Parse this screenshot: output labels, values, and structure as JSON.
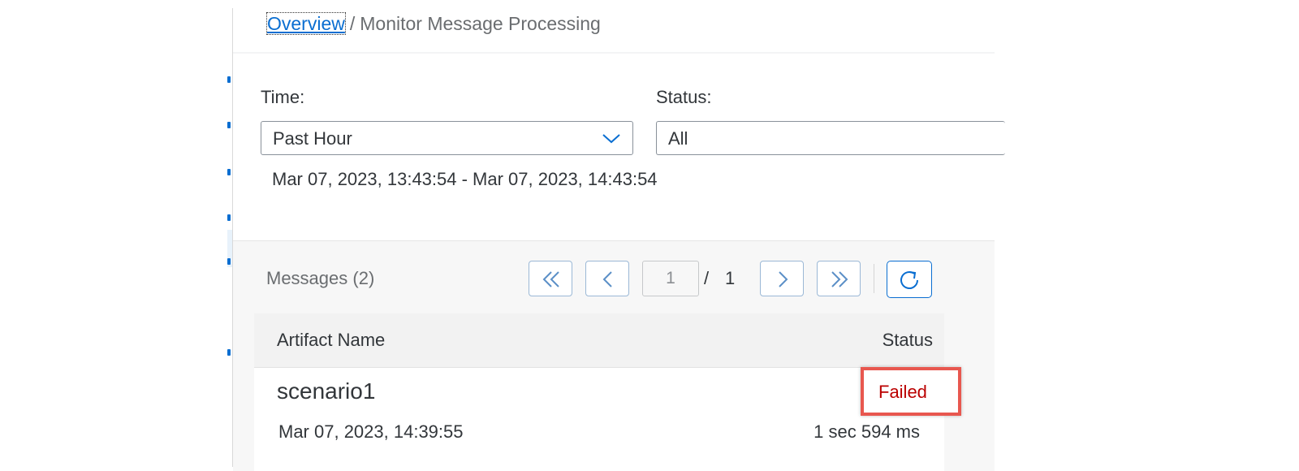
{
  "breadcrumb": {
    "link": "Overview",
    "separator": "/",
    "current": "Monitor Message Processing"
  },
  "filters": {
    "time": {
      "label": "Time:",
      "value": "Past Hour",
      "icon": "chevron-down-icon"
    },
    "status": {
      "label": "Status:",
      "value": "All"
    },
    "range": "Mar 07, 2023, 13:43:54 - Mar 07, 2023, 14:43:54"
  },
  "messages": {
    "title": "Messages (2)",
    "pagination": {
      "current_page": "1",
      "separator": "/",
      "total_pages": "1",
      "icons": [
        "first-page-icon",
        "previous-page-icon",
        "next-page-icon",
        "last-page-icon",
        "refresh-icon"
      ]
    },
    "columns": {
      "name": "Artifact Name",
      "status": "Status"
    },
    "rows": [
      {
        "name": "scenario1",
        "date": "Mar 07, 2023, 14:39:55",
        "duration": "1 sec 594 ms",
        "status": "Failed"
      }
    ]
  },
  "colors": {
    "accent": "#0a6ed1",
    "error_text": "#bb0000",
    "highlight_border": "#e8574f"
  }
}
